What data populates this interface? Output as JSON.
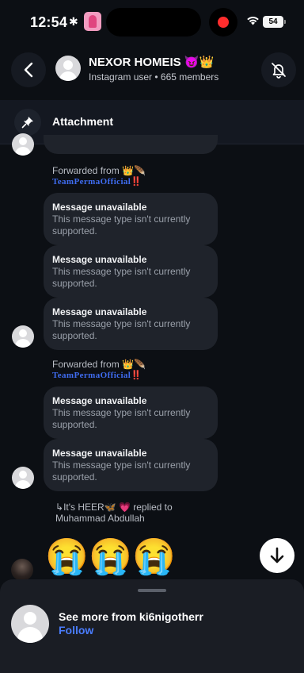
{
  "status_bar": {
    "time": "12:54",
    "battery": "54",
    "colors": {
      "record_dot": "#ff2d2d"
    }
  },
  "header": {
    "title": "NEXOR HOMEIS 😈👑",
    "subtitle": "Instagram user • 665 members"
  },
  "attachment_bar": {
    "label": "Attachment"
  },
  "messages": {
    "forward_1": {
      "label": "Forwarded from 👑🪶",
      "source": "TeamPermaOfficial",
      "marks": "‼️"
    },
    "bubbles_1": [
      {
        "title": "Message unavailable",
        "body": "This message type isn't currently supported."
      },
      {
        "title": "Message unavailable",
        "body": "This message type isn't currently supported."
      },
      {
        "title": "Message unavailable",
        "body": "This message type isn't currently supported."
      }
    ],
    "forward_2": {
      "label": "Forwarded from 👑🪶",
      "source": "TeamPermaOfficial",
      "marks": "‼️"
    },
    "bubbles_2": [
      {
        "title": "Message unavailable",
        "body": "This message type isn't currently supported."
      },
      {
        "title": "Message unavailable",
        "body": "This message type isn't currently supported."
      }
    ],
    "reply_note": {
      "prefix": "It's HEER",
      "emoji": "🦋 💗",
      "text": "replied to",
      "target": "Muhammad Abdullah"
    },
    "emoji_reaction": [
      "😭",
      "😭",
      "😭"
    ]
  },
  "bottom_sheet": {
    "see_more": "See more from ki6nigotherr",
    "follow": "Follow"
  },
  "icons": {
    "back": "chevron-left-icon",
    "mute": "bell-slash-icon",
    "pin": "pin-icon",
    "scroll_down": "arrow-down-icon"
  }
}
